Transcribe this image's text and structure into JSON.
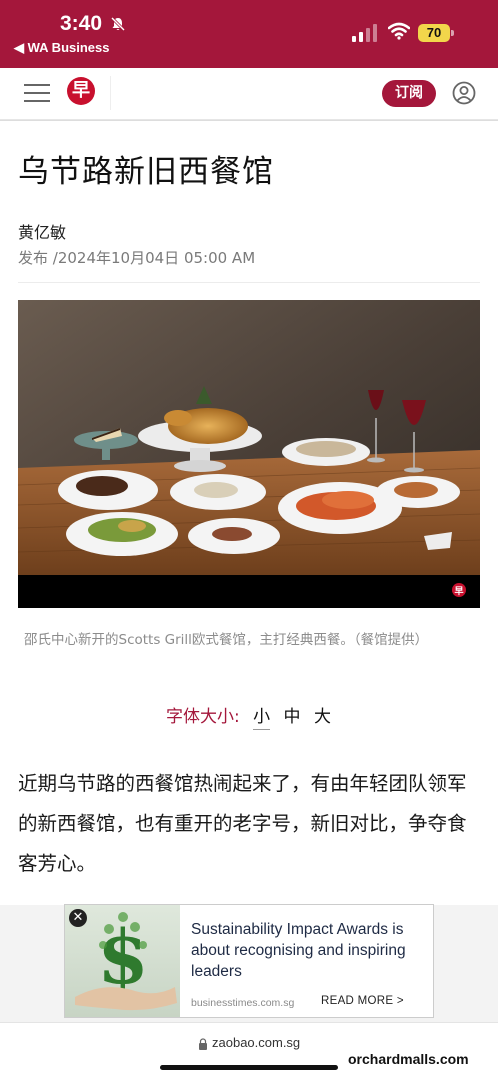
{
  "status_bar": {
    "time": "3:40",
    "back_label": "◀ WA Business",
    "battery": "70"
  },
  "header": {
    "logo_char": "早",
    "subscribe_label": "订阅"
  },
  "article": {
    "title": "乌节路新旧西餐馆",
    "author": "黄亿敏",
    "published": "发布 /2024年10月04日 05:00 AM",
    "photo_caption": "邵氏中心新开的Scotts Grill欧式餐馆，主打经典西餐。（餐馆提供）",
    "font_size_label": "字体大小:",
    "font_size_options": [
      "小",
      "中",
      "大"
    ],
    "body": "近期乌节路的西餐馆热闹起来了，有由年轻团队领军的新西餐馆，也有重开的老字号，新旧对比，争夺食客芳心。"
  },
  "ad": {
    "headline": "Sustainability Impact Awards is about recognising and inspiring leaders",
    "source": "businesstimes.com.sg",
    "cta": "READ MORE >"
  },
  "browser": {
    "url": "zaobao.com.sg"
  },
  "watermark": "orchardmalls.com",
  "colors": {
    "brand": "#a4173b",
    "logo_red": "#c8102e"
  }
}
